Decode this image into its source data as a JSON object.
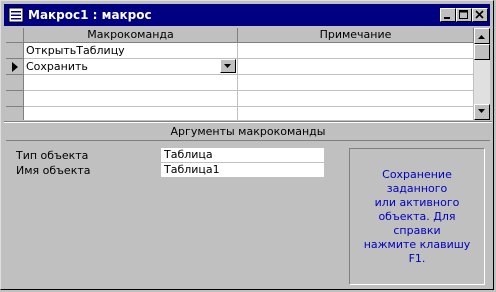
{
  "window": {
    "title": "Макрос1 : макрос"
  },
  "grid": {
    "columns": [
      "Макрокоманда",
      "Примечание"
    ],
    "rows": [
      {
        "action": "ОткрытьТаблицу",
        "note": ""
      },
      {
        "action": "Сохранить",
        "note": ""
      },
      {
        "action": "",
        "note": ""
      },
      {
        "action": "",
        "note": ""
      },
      {
        "action": "",
        "note": ""
      }
    ],
    "current_row_index": 1
  },
  "arguments": {
    "title": "Аргументы макрокоманды",
    "object_type_label": "Тип объекта",
    "object_type_value": "Таблица",
    "object_name_label": "Имя объекта",
    "object_name_value": "Таблица1"
  },
  "help_text": "Сохранение заданного\nили активного\nобъекта. Для справки\nнажмите клавишу F1.",
  "colors": {
    "titlebar": "#000080",
    "help_text": "#0000c0",
    "face": "#c0c0c0"
  }
}
